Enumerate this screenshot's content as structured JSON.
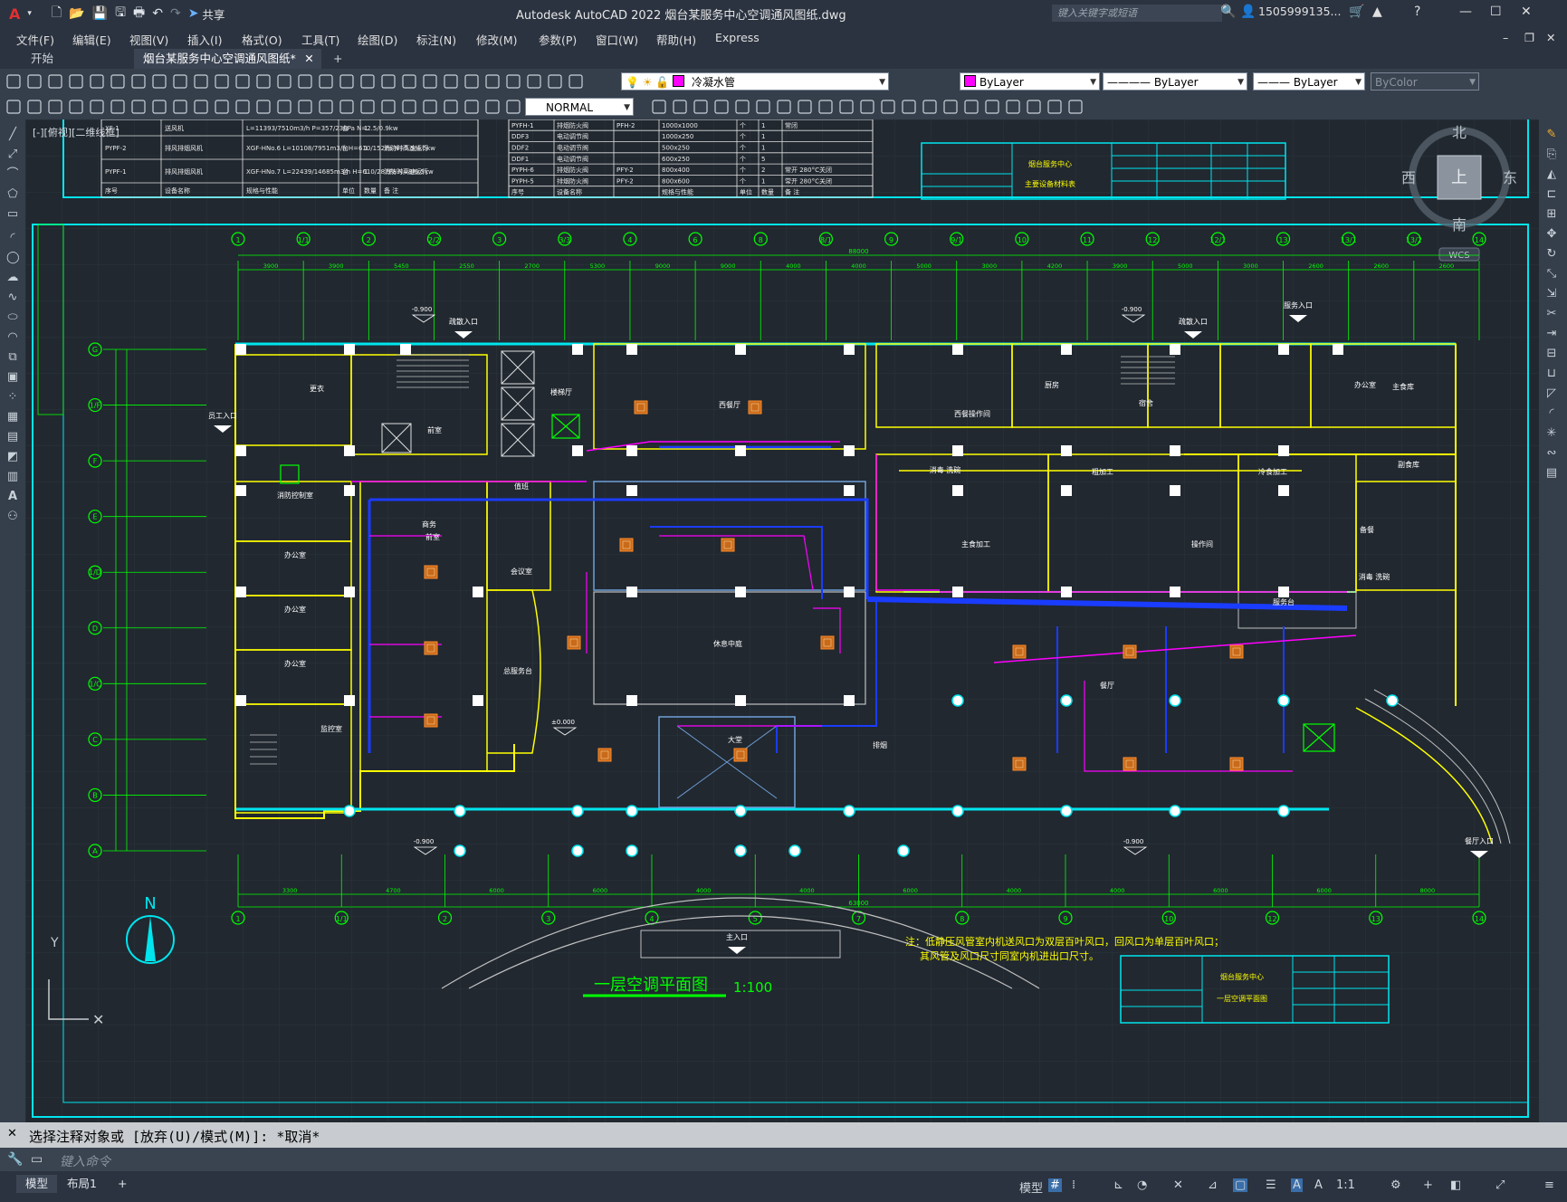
{
  "title_bar": {
    "app_title": "Autodesk AutoCAD 2022    烟台某服务中心空调通风图纸.dwg",
    "share_label": "共享",
    "search_placeholder": "键入关键字或短语",
    "user_name": "1505999135..."
  },
  "menu": [
    "文件(F)",
    "编辑(E)",
    "视图(V)",
    "插入(I)",
    "格式(O)",
    "工具(T)",
    "绘图(D)",
    "标注(N)",
    "修改(M)",
    "参数(P)",
    "窗口(W)",
    "帮助(H)",
    "Express"
  ],
  "tabs": {
    "start": "开始",
    "active": "烟台某服务中心空调通风图纸*"
  },
  "toolbar": {
    "layer_name": "冷凝水管",
    "color": "ByLayer",
    "linetype": "ByLayer",
    "lineweight": "ByLayer",
    "plotstyle": "ByColor",
    "textstyle": "NORMAL"
  },
  "viewport": {
    "label": "[-][俯视][二维线框]"
  },
  "viewcube": {
    "north": "北",
    "south": "南",
    "east": "东",
    "west": "西",
    "top": "上",
    "wcs": "WCS"
  },
  "drawing": {
    "plan_title": "一层空调平面图",
    "scale": "1:100",
    "note_line1": "注：低静压风管室内机送风口为双层百叶风口，回风口为单层百叶风口；",
    "note_line2": "其风管及风口尺寸同室内机进出口尺寸。",
    "north_label": "N",
    "axis_top": [
      "1",
      "1/1",
      "2",
      "2/2",
      "3",
      "3/3",
      "4",
      "6",
      "8",
      "8/1",
      "9",
      "9/1",
      "10",
      "11",
      "12",
      "12/1",
      "13",
      "13/1",
      "13/2",
      "14"
    ],
    "axis_bottom": [
      "1",
      "1/1",
      "2",
      "3",
      "4",
      "5",
      "7",
      "8",
      "9",
      "10",
      "12",
      "13",
      "14"
    ],
    "axis_left": [
      "G",
      "1/F",
      "F",
      "E",
      "1/D",
      "D",
      "1/C",
      "C",
      "B",
      "A"
    ],
    "dims_top": [
      "3900",
      "3900",
      "5450",
      "2550",
      "2700",
      "5300",
      "9000",
      "9000",
      "4000",
      "4000",
      "5000",
      "3000",
      "4200",
      "3900",
      "5000",
      "3000",
      "2600",
      "2600",
      "2600"
    ],
    "dims_bottom": [
      "3300",
      "4700",
      "6000",
      "6000",
      "4000",
      "4000",
      "6000",
      "4000",
      "4000",
      "6000",
      "6000",
      "8000"
    ],
    "overall_top": "88000",
    "overall_bottom": "63000",
    "rooms": [
      "楼梯厅",
      "西餐厅",
      "前室",
      "宿舍",
      "更衣",
      "消防控制室",
      "办公室",
      "办公室",
      "办公室",
      "商务",
      "监控室",
      "值班",
      "总服务台",
      "西餐操作间",
      "厨房",
      "消毒 洗碗",
      "粗加工",
      "冷食加工",
      "备餐",
      "主食加工",
      "操作间",
      "服务台",
      "办公室",
      "主食库",
      "副食库",
      "消毒 洗碗",
      "餐厅",
      "休息中庭",
      "大堂",
      "排烟",
      "会议室",
      "前室"
    ],
    "entrances": [
      "疏散入口",
      "疏散入口",
      "服务入口",
      "员工入口",
      "餐厅入口",
      "主入口"
    ],
    "levels": [
      "-0.900",
      "-0.900",
      "-0.900",
      "-0.900",
      "±0.000"
    ],
    "equipment_table_left": [
      [
        "序号",
        "设备名称",
        "规格与性能",
        "单位",
        "数量",
        "备 注"
      ],
      [
        "XF-1",
        "送风机",
        "L=11393/7510m3/h P=357/236Pa N=2.5/0.9kw",
        "台",
        "1",
        ""
      ],
      [
        "PYPF-2",
        "排风排烟风机",
        "XGF-HNo.6 L=10108/7951m3/h H=610/152Pa N=5.5/4.5kw",
        "台",
        "1",
        "消防时高速运行"
      ],
      [
        "PYPF-1",
        "排风排烟风机",
        "XGF-HNo.7 L=22439/14685m3/h H=610/287Pa N=8/6.5kw",
        "台",
        "1",
        "消防时高速运行"
      ]
    ],
    "equipment_table_right": [
      [
        "序号",
        "设备名称",
        "",
        "规格与性能",
        "单位",
        "数量",
        "备 注"
      ],
      [
        "PYFH-1",
        "排烟防火阀",
        "PFH-2",
        "1000x1000",
        "个",
        "1",
        "常闭"
      ],
      [
        "DDF3",
        "电动调节阀",
        "",
        "1000x250",
        "个",
        "1",
        ""
      ],
      [
        "DDF2",
        "电动调节阀",
        "",
        "500x250",
        "个",
        "1",
        ""
      ],
      [
        "DDF1",
        "电动调节阀",
        "",
        "600x250",
        "个",
        "5",
        ""
      ],
      [
        "PYPH-6",
        "排烟防火阀",
        "PFY-2",
        "800x400",
        "个",
        "2",
        "常开 280°C关闭"
      ],
      [
        "PYPH-5",
        "排烟防火阀",
        "PFY-2",
        "800x600",
        "个",
        "1",
        "常开 280°C关闭"
      ]
    ],
    "titleblock_top": {
      "project": "烟台服务中心",
      "drawing": "主要设备材料表"
    },
    "titleblock_bottom": {
      "project": "烟台服务中心",
      "drawing": "一层空调平面图"
    }
  },
  "command": {
    "history": "选择注释对象或 [放弃(U)/模式(M)]: *取消*",
    "placeholder": "键入命令"
  },
  "status": {
    "tab_model": "模型",
    "tab_layout": "布局1",
    "model_label": "模型",
    "scale": "1:1"
  }
}
